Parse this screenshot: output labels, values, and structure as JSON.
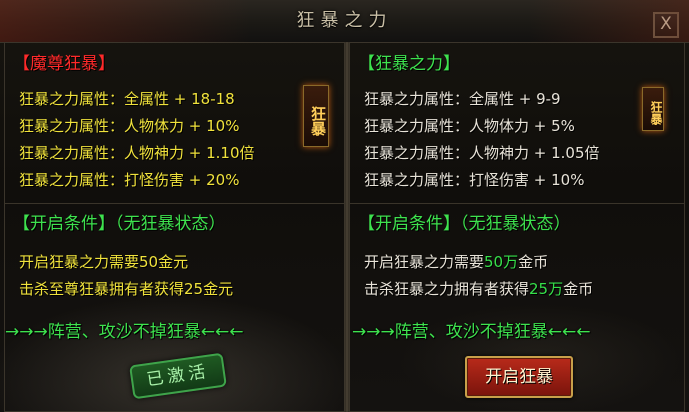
{
  "window": {
    "title": "狂暴之力",
    "close_label": "X"
  },
  "left": {
    "section_title": "【魔尊狂暴】",
    "attributes": [
      "狂暴之力属性：全属性 + 18-18",
      "狂暴之力属性：人物体力 + 10%",
      "狂暴之力属性：人物神力 + 1.10倍",
      "狂暴之力属性：打怪伤害 + 20%"
    ],
    "badge_text": "狂暴",
    "condition_title": "【开启条件】（无狂暴状态）",
    "conditions": [
      {
        "before": "开启狂暴之力需要",
        "value": "50金元",
        "after": ""
      },
      {
        "before": "击杀至尊狂暴拥有者获得",
        "value": "25金元",
        "after": ""
      }
    ],
    "slogan": "→→→阵营、攻沙不掉狂暴←←←",
    "status_stamp": "已激活"
  },
  "right": {
    "section_title": "【狂暴之力】",
    "attributes": [
      "狂暴之力属性：全属性 + 9-9",
      "狂暴之力属性：人物体力 + 5%",
      "狂暴之力属性：人物神力 + 1.05倍",
      "狂暴之力属性：打怪伤害 + 10%"
    ],
    "badge_text": "狂暴",
    "condition_title": "【开启条件】（无狂暴状态）",
    "conditions": [
      {
        "before": "开启狂暴之力需要",
        "value": "50万",
        "after": "金币"
      },
      {
        "before": "击杀狂暴之力拥有者获得",
        "value": "25万",
        "after": "金币"
      }
    ],
    "slogan": "→→→阵营、攻沙不掉狂暴←←←",
    "start_button": "开启狂暴"
  },
  "colors": {
    "left_title": "#ff2a2a",
    "right_title": "#3ee24e",
    "condition_title": "#3ee24e",
    "highlight": "#36e04a"
  }
}
